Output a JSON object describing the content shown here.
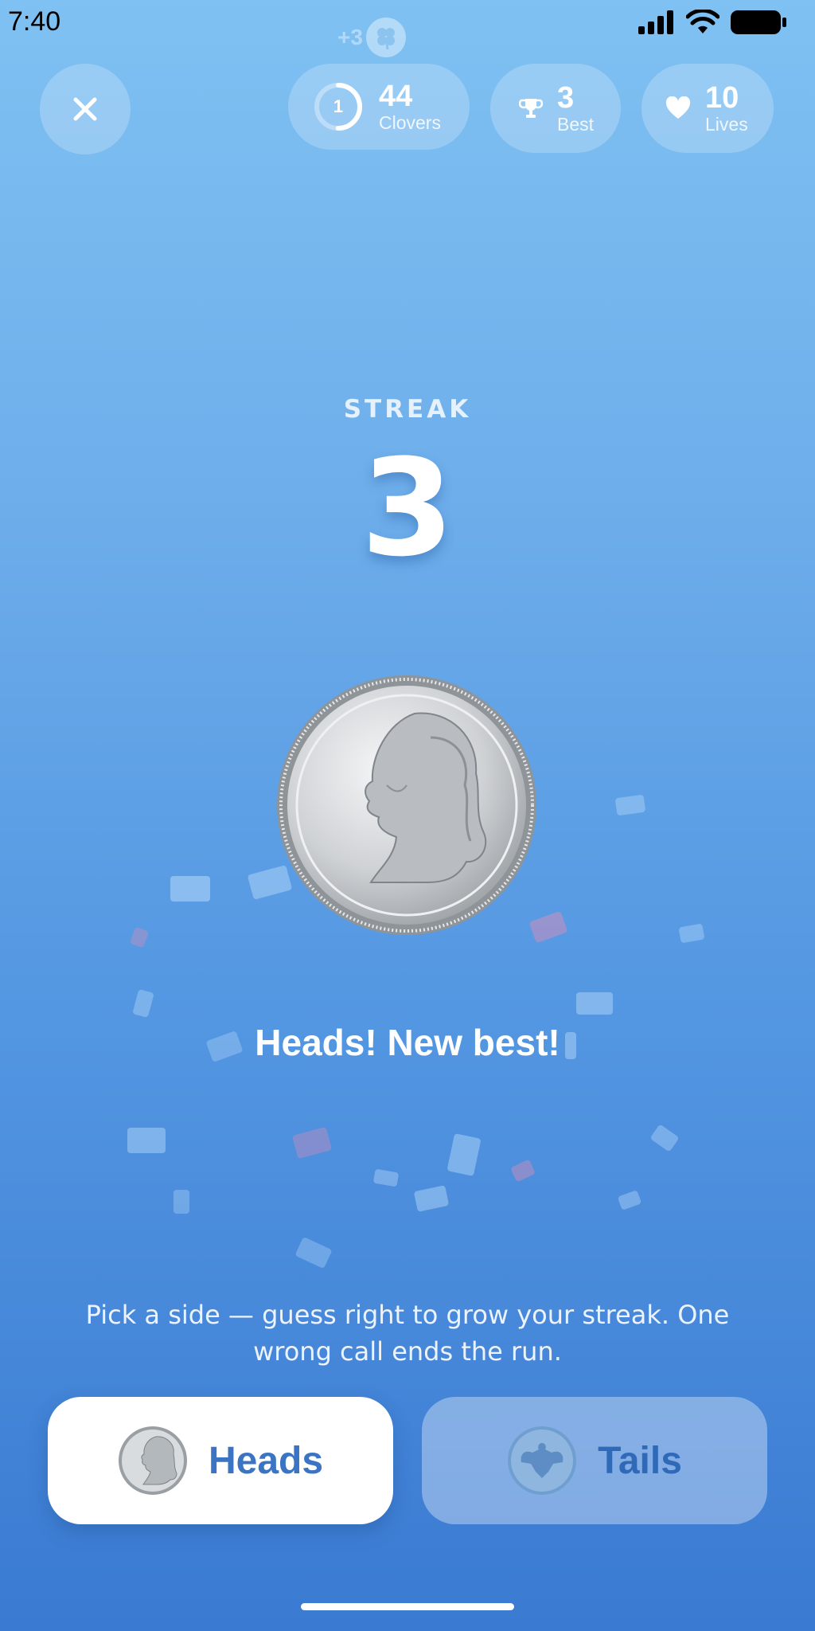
{
  "status": {
    "time": "7:40"
  },
  "reward_float": {
    "amount": "+3"
  },
  "header": {
    "clovers": {
      "ring_value": "1",
      "count": "44",
      "label": "Clovers"
    },
    "best": {
      "count": "3",
      "label": "Best"
    },
    "lives": {
      "count": "10",
      "label": "Lives"
    }
  },
  "streak": {
    "label": "STREAK",
    "value": "3"
  },
  "result": {
    "text": "Heads! New best!"
  },
  "hint": {
    "text": "Pick a side — guess right to grow your streak. One wrong call ends the run."
  },
  "choices": {
    "heads_label": "Heads",
    "tails_label": "Tails"
  },
  "colors": {
    "accent": "#3a74c2",
    "bg_top": "#7fc1f2",
    "bg_bottom": "#3a7ad2"
  }
}
